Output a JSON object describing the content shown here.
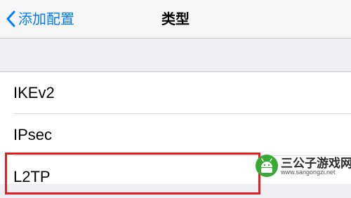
{
  "nav": {
    "back_label": "添加配置",
    "title": "类型"
  },
  "type_list": {
    "items": [
      {
        "label": "IKEv2"
      },
      {
        "label": "IPsec"
      },
      {
        "label": "L2TP"
      }
    ]
  },
  "highlight": {
    "color": "#e02020",
    "target": "L2TP"
  },
  "watermark": {
    "title": "三公子游戏网",
    "url": "www.sangongzi.net",
    "logo_icon": "android-robot-icon",
    "logo_color": "#3aa835"
  },
  "colors": {
    "accent": "#007aff",
    "background": "#efeff4",
    "list_background": "#ffffff"
  }
}
